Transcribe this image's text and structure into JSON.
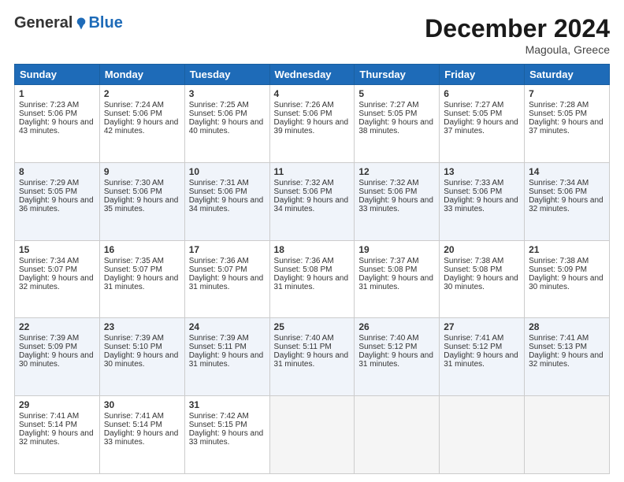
{
  "logo": {
    "general": "General",
    "blue": "Blue"
  },
  "header": {
    "month": "December 2024",
    "location": "Magoula, Greece"
  },
  "weekdays": [
    "Sunday",
    "Monday",
    "Tuesday",
    "Wednesday",
    "Thursday",
    "Friday",
    "Saturday"
  ],
  "weeks": [
    [
      {
        "day": 1,
        "sunrise": "7:23 AM",
        "sunset": "5:06 PM",
        "daylight": "9 hours and 43 minutes."
      },
      {
        "day": 2,
        "sunrise": "7:24 AM",
        "sunset": "5:06 PM",
        "daylight": "9 hours and 42 minutes."
      },
      {
        "day": 3,
        "sunrise": "7:25 AM",
        "sunset": "5:06 PM",
        "daylight": "9 hours and 40 minutes."
      },
      {
        "day": 4,
        "sunrise": "7:26 AM",
        "sunset": "5:06 PM",
        "daylight": "9 hours and 39 minutes."
      },
      {
        "day": 5,
        "sunrise": "7:27 AM",
        "sunset": "5:05 PM",
        "daylight": "9 hours and 38 minutes."
      },
      {
        "day": 6,
        "sunrise": "7:27 AM",
        "sunset": "5:05 PM",
        "daylight": "9 hours and 37 minutes."
      },
      {
        "day": 7,
        "sunrise": "7:28 AM",
        "sunset": "5:05 PM",
        "daylight": "9 hours and 37 minutes."
      }
    ],
    [
      {
        "day": 8,
        "sunrise": "7:29 AM",
        "sunset": "5:05 PM",
        "daylight": "9 hours and 36 minutes."
      },
      {
        "day": 9,
        "sunrise": "7:30 AM",
        "sunset": "5:06 PM",
        "daylight": "9 hours and 35 minutes."
      },
      {
        "day": 10,
        "sunrise": "7:31 AM",
        "sunset": "5:06 PM",
        "daylight": "9 hours and 34 minutes."
      },
      {
        "day": 11,
        "sunrise": "7:32 AM",
        "sunset": "5:06 PM",
        "daylight": "9 hours and 34 minutes."
      },
      {
        "day": 12,
        "sunrise": "7:32 AM",
        "sunset": "5:06 PM",
        "daylight": "9 hours and 33 minutes."
      },
      {
        "day": 13,
        "sunrise": "7:33 AM",
        "sunset": "5:06 PM",
        "daylight": "9 hours and 33 minutes."
      },
      {
        "day": 14,
        "sunrise": "7:34 AM",
        "sunset": "5:06 PM",
        "daylight": "9 hours and 32 minutes."
      }
    ],
    [
      {
        "day": 15,
        "sunrise": "7:34 AM",
        "sunset": "5:07 PM",
        "daylight": "9 hours and 32 minutes."
      },
      {
        "day": 16,
        "sunrise": "7:35 AM",
        "sunset": "5:07 PM",
        "daylight": "9 hours and 31 minutes."
      },
      {
        "day": 17,
        "sunrise": "7:36 AM",
        "sunset": "5:07 PM",
        "daylight": "9 hours and 31 minutes."
      },
      {
        "day": 18,
        "sunrise": "7:36 AM",
        "sunset": "5:08 PM",
        "daylight": "9 hours and 31 minutes."
      },
      {
        "day": 19,
        "sunrise": "7:37 AM",
        "sunset": "5:08 PM",
        "daylight": "9 hours and 31 minutes."
      },
      {
        "day": 20,
        "sunrise": "7:38 AM",
        "sunset": "5:08 PM",
        "daylight": "9 hours and 30 minutes."
      },
      {
        "day": 21,
        "sunrise": "7:38 AM",
        "sunset": "5:09 PM",
        "daylight": "9 hours and 30 minutes."
      }
    ],
    [
      {
        "day": 22,
        "sunrise": "7:39 AM",
        "sunset": "5:09 PM",
        "daylight": "9 hours and 30 minutes."
      },
      {
        "day": 23,
        "sunrise": "7:39 AM",
        "sunset": "5:10 PM",
        "daylight": "9 hours and 30 minutes."
      },
      {
        "day": 24,
        "sunrise": "7:39 AM",
        "sunset": "5:11 PM",
        "daylight": "9 hours and 31 minutes."
      },
      {
        "day": 25,
        "sunrise": "7:40 AM",
        "sunset": "5:11 PM",
        "daylight": "9 hours and 31 minutes."
      },
      {
        "day": 26,
        "sunrise": "7:40 AM",
        "sunset": "5:12 PM",
        "daylight": "9 hours and 31 minutes."
      },
      {
        "day": 27,
        "sunrise": "7:41 AM",
        "sunset": "5:12 PM",
        "daylight": "9 hours and 31 minutes."
      },
      {
        "day": 28,
        "sunrise": "7:41 AM",
        "sunset": "5:13 PM",
        "daylight": "9 hours and 32 minutes."
      }
    ],
    [
      {
        "day": 29,
        "sunrise": "7:41 AM",
        "sunset": "5:14 PM",
        "daylight": "9 hours and 32 minutes."
      },
      {
        "day": 30,
        "sunrise": "7:41 AM",
        "sunset": "5:14 PM",
        "daylight": "9 hours and 33 minutes."
      },
      {
        "day": 31,
        "sunrise": "7:42 AM",
        "sunset": "5:15 PM",
        "daylight": "9 hours and 33 minutes."
      },
      null,
      null,
      null,
      null
    ]
  ]
}
